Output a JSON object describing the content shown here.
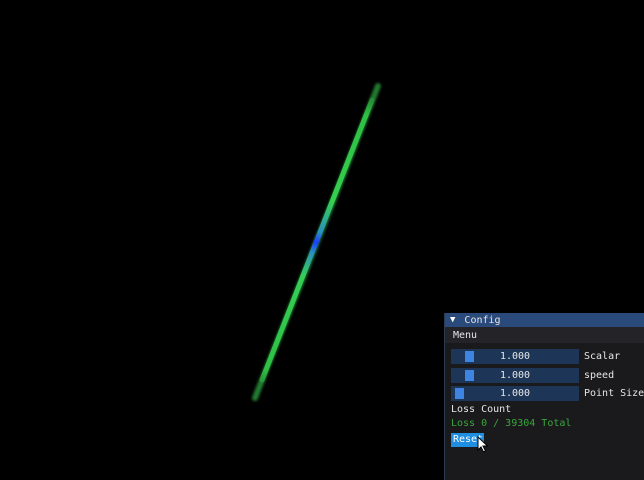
{
  "panel": {
    "title": "Config",
    "menu_label": "Menu",
    "sliders": [
      {
        "label": "Scalar",
        "value_text": "1.000",
        "fill": 0.1
      },
      {
        "label": "speed",
        "value_text": "1.000",
        "fill": 0.1
      },
      {
        "label": "Point Size",
        "value_text": "1.000",
        "fill": 0.02
      }
    ],
    "loss_label": "Loss Count",
    "loss_text": "Loss 0 / 39304 Total",
    "reset_label": "Reset"
  },
  "colors": {
    "background": "#000000",
    "streak_green": "#2bd24a",
    "streak_blue": "#1a3cff",
    "panel_title": "#294a7a",
    "accent": "#1f8de0",
    "loss_text": "#3aa63a"
  },
  "icons": {
    "collapse": "triangle-down-icon",
    "cursor": "mouse-pointer-icon"
  }
}
